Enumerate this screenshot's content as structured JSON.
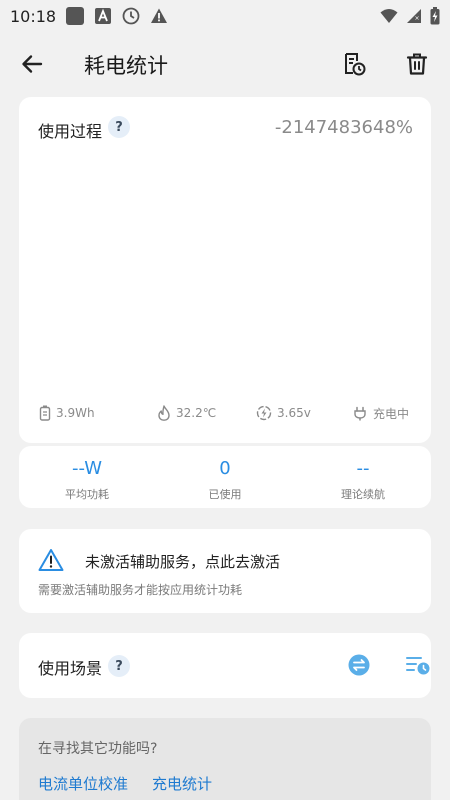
{
  "status_bar": {
    "time": "10:18",
    "left_icons": [
      "notification-square-icon",
      "font-a-icon",
      "clock-icon",
      "warning-icon"
    ],
    "right_icons": [
      "wifi-icon",
      "cellular-signal-icon",
      "battery-charging-icon"
    ]
  },
  "app_bar": {
    "back_icon": "arrow-left-icon",
    "title": "耗电统计",
    "actions": [
      "history-icon",
      "delete-icon"
    ]
  },
  "usage_card": {
    "title": "使用过程",
    "help": "?",
    "percent": "-2147483648%",
    "metrics": {
      "capacity": "3.9Wh",
      "temperature": "32.2℃",
      "voltage": "3.65v",
      "state": "充电中"
    }
  },
  "stats": {
    "avg_power": {
      "value": "--W",
      "label": "平均功耗"
    },
    "used": {
      "value": "0",
      "label": "已使用"
    },
    "endurance": {
      "value": "--",
      "label": "理论续航"
    }
  },
  "warning_card": {
    "title": "未激活辅助服务，点此去激活",
    "description": "需要激活辅助服务才能按应用统计功耗"
  },
  "scene_card": {
    "title": "使用场景",
    "help": "?"
  },
  "more_card": {
    "title": "在寻找其它功能吗?",
    "links": [
      "电流单位校准",
      "充电统计"
    ]
  },
  "colors": {
    "accent": "#2a8de2",
    "link": "#1e7ad0",
    "background": "#f1f1f1",
    "card": "#ffffff"
  }
}
